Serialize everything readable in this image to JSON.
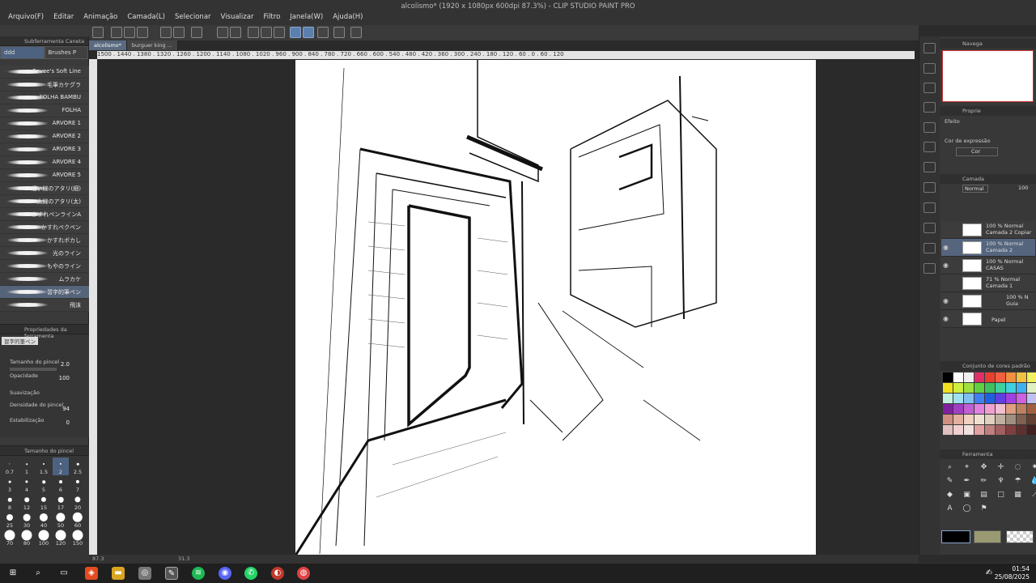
{
  "app": {
    "title": "alcolismo* (1920 x 1080px 600dpi 87.3%) - CLIP STUDIO PAINT PRO",
    "menu": [
      "Arquivo(F)",
      "Editar",
      "Animação",
      "Camada(L)",
      "Selecionar",
      "Visualizar",
      "Filtro",
      "Janela(W)",
      "Ajuda(H)"
    ]
  },
  "subtool": {
    "header": "Subferramenta Caneta",
    "tabs": [
      "ddd",
      "Brushes P"
    ],
    "brushes": [
      "Eevee's Soft Line",
      "毛筆カケグラ",
      "FOLHA BAMBU",
      "FOLHA",
      "ARVORE 1",
      "ARVORE 2",
      "ARVORE 3",
      "ARVORE 4",
      "ARVORE 5",
      "細い線のアタリ(細)",
      "太線のアタリ(太)",
      "かすれペンラインA",
      "かすれペクペン",
      "かすれボカし",
      "光のライン",
      "もやのライン",
      "ムラカケ",
      "習字的筆ペン",
      "飛沫"
    ]
  },
  "toolprops": {
    "header": "Propriedades da ferramenta",
    "brush_name": "習字的筆ペン",
    "size_label": "Tamanho do pincel",
    "size_value": "2.0",
    "opacity_label": "Opacidade",
    "opacity_value": "100",
    "smooth_label": "Suavização",
    "density_label": "Densidade do pincel",
    "density_value": "94",
    "stab_label": "Estabilização",
    "stab_value": "0"
  },
  "brushsize": {
    "header": "Tamanho do pincel",
    "sizes": [
      "0.7",
      "1",
      "1.5",
      "2",
      "2.5",
      "3",
      "4",
      "5",
      "6",
      "7",
      "8",
      "12",
      "15",
      "17",
      "20",
      "25",
      "30",
      "40",
      "50",
      "60",
      "70",
      "80",
      "100",
      "120",
      "150"
    ],
    "selected": "2"
  },
  "canvas": {
    "tabs": [
      "alcolismo*",
      "burguer king ..."
    ],
    "ruler": "1500 . 1440 . 1380 . 1320 . 1260 . 1200 . 1140 . 1080 . 1020 . 960 . 900 . 840 . 780 . 720 . 660 . 600 . 540 . 480 . 420 . 360 . 300 . 240 . 180 . 120 . 60 . 0 . 60 . 120",
    "zoom": "87.3",
    "angle": "31.3"
  },
  "navigator": {
    "header": "Navega"
  },
  "properties": {
    "header": "Proprie",
    "effect_label": "Efeito",
    "expr_label": "Cor de expressão",
    "expr_value": "Cor"
  },
  "layers": {
    "header": "Camada",
    "blend": "Normal",
    "opacity": "100",
    "items": [
      {
        "pct": "100 % Normal",
        "name": "Camada 2 Copiar"
      },
      {
        "pct": "100 % Normal",
        "name": "Camada 2"
      },
      {
        "pct": "100 % Normal",
        "name": "CASAS"
      },
      {
        "pct": "71 % Normal",
        "name": "Camada 1"
      },
      {
        "pct": "100 % N",
        "name": "Guia"
      },
      {
        "pct": "",
        "name": "Papel"
      }
    ]
  },
  "colorset": {
    "header": "Conjunto de cores padrão"
  },
  "tools_panel": {
    "header": "Ferramenta"
  },
  "colors": {
    "main": "#000000",
    "sub": "#9a9a72",
    "accent": "#5b7fae"
  },
  "taskbar": {
    "time": "01:54",
    "date": "25/08/2025"
  }
}
